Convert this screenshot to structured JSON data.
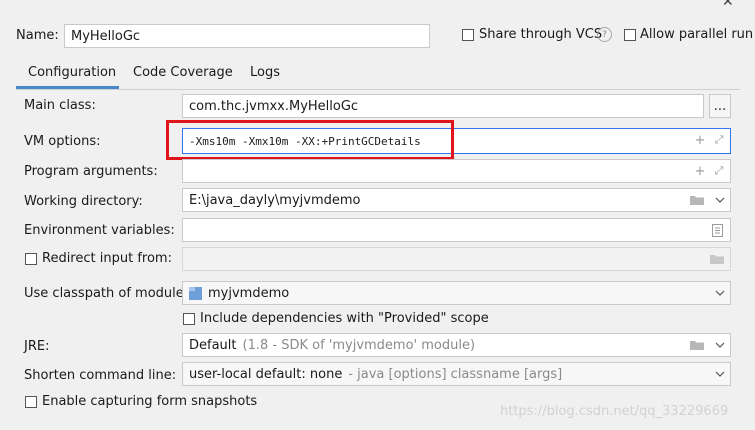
{
  "window": {
    "close_glyph": "✕"
  },
  "name": {
    "label": "Name:",
    "value": "MyHelloGc"
  },
  "share_vcs": {
    "label": "Share through VCS",
    "checked": false
  },
  "allow_parallel": {
    "label": "Allow parallel run",
    "checked": false
  },
  "tabs": [
    {
      "label": "Configuration",
      "active": true
    },
    {
      "label": "Code Coverage",
      "active": false
    },
    {
      "label": "Logs",
      "active": false
    }
  ],
  "form": {
    "main_class": {
      "label": "Main class:",
      "value": "com.thc.jvmxx.MyHelloGc",
      "browse_label": "..."
    },
    "vm_options": {
      "label": "VM options:",
      "value": "-Xms10m -Xmx10m -XX:+PrintGCDetails"
    },
    "program_args": {
      "label": "Program arguments:",
      "value": ""
    },
    "working_dir": {
      "label": "Working directory:",
      "value": "E:\\java_dayly\\myjvmdemo"
    },
    "env_vars": {
      "label": "Environment variables:",
      "value": ""
    },
    "redirect_input": {
      "label": "Redirect input from:",
      "checked": false,
      "value": ""
    },
    "classpath_module": {
      "label": "Use classpath of module:",
      "value": "myjvmdemo"
    },
    "include_provided": {
      "label": "Include dependencies with \"Provided\" scope",
      "checked": false
    },
    "jre": {
      "label": "JRE:",
      "value": "Default",
      "detail": "(1.8 - SDK of 'myjvmdemo' module)"
    },
    "shorten_cmd": {
      "label": "Shorten command line:",
      "value": "user-local default: none",
      "detail": "- java [options] classname [args]"
    },
    "capture_forms": {
      "label": "Enable capturing form snapshots",
      "checked": false
    }
  },
  "watermark": "https://blog.csdn.net/qq_33229669",
  "colors": {
    "highlight": "#e0151b",
    "tab_underline": "#4a88c7",
    "accent_blue": "#3574f0"
  }
}
